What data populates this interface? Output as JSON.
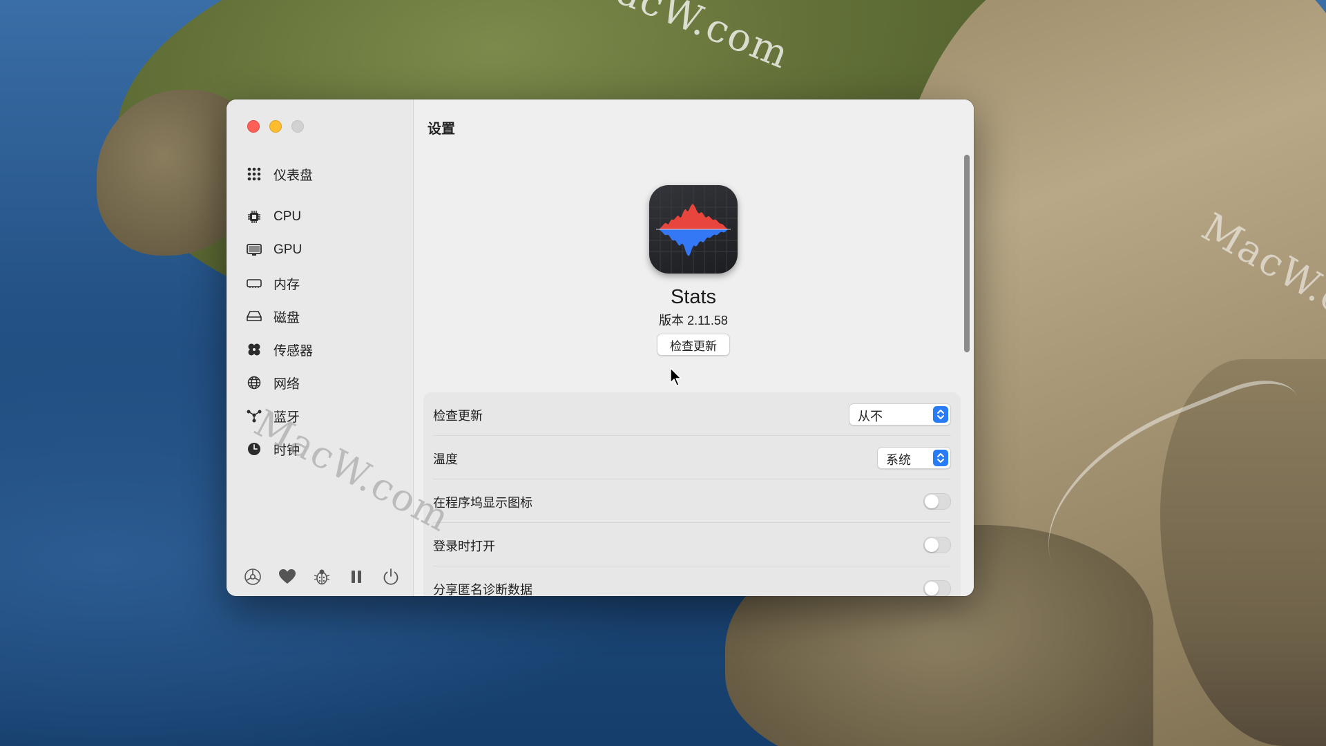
{
  "watermarks": [
    "MacW.com",
    "MacW.c",
    "MacW.com"
  ],
  "window": {
    "sidebar": {
      "items": [
        {
          "label": "仪表盘",
          "icon": "dashboard-grid-icon"
        },
        {
          "label": "CPU",
          "icon": "cpu-chip-icon"
        },
        {
          "label": "GPU",
          "icon": "gpu-display-icon"
        },
        {
          "label": "内存",
          "icon": "memory-icon"
        },
        {
          "label": "磁盘",
          "icon": "disk-icon"
        },
        {
          "label": "传感器",
          "icon": "sensors-fan-icon"
        },
        {
          "label": "网络",
          "icon": "network-globe-icon"
        },
        {
          "label": "蓝牙",
          "icon": "bluetooth-nodes-icon"
        },
        {
          "label": "时钟",
          "icon": "clock-icon"
        }
      ],
      "bottom_tools": [
        "settings-gear-icon",
        "heart-icon",
        "bug-icon",
        "pause-icon",
        "power-icon"
      ]
    },
    "main": {
      "title": "设置",
      "app": {
        "name": "Stats",
        "version": "版本 2.11.58",
        "check_button": "检查更新",
        "icon": "stats-waveform-icon"
      },
      "settings": [
        {
          "label": "检查更新",
          "control": "select",
          "value": "从不"
        },
        {
          "label": "温度",
          "control": "select",
          "value": "系统"
        },
        {
          "label": "在程序坞显示图标",
          "control": "toggle",
          "on": false
        },
        {
          "label": "登录时打开",
          "control": "toggle",
          "on": false
        },
        {
          "label": "分享匿名诊断数据",
          "control": "toggle",
          "on": false
        }
      ]
    }
  },
  "colors": {
    "close": "#fe5f57",
    "minimize": "#febc2e",
    "zoom": "#d1d1d1",
    "select_accent": "#2a7cf6",
    "wave_red": "#e8453c",
    "wave_blue": "#3478f6"
  }
}
